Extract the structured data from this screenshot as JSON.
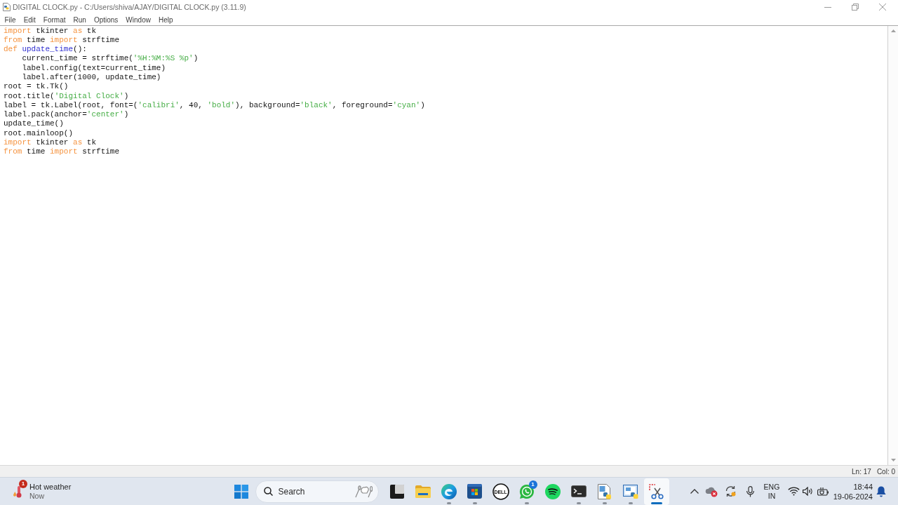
{
  "window": {
    "title": "DIGITAL CLOCK.py - C:/Users/shiva/AJAY/DIGITAL CLOCK.py (3.11.9)"
  },
  "menu": [
    "File",
    "Edit",
    "Format",
    "Run",
    "Options",
    "Window",
    "Help"
  ],
  "editor": {
    "lines": [
      {
        "tokens": [
          {
            "text": "import",
            "kind": "keyword"
          },
          {
            "text": " tkinter ",
            "kind": "plain"
          },
          {
            "text": "as",
            "kind": "keyword"
          },
          {
            "text": " tk",
            "kind": "plain"
          }
        ]
      },
      {
        "tokens": [
          {
            "text": "from",
            "kind": "keyword"
          },
          {
            "text": " time ",
            "kind": "plain"
          },
          {
            "text": "import",
            "kind": "keyword"
          },
          {
            "text": " strftime",
            "kind": "plain"
          }
        ]
      },
      {
        "tokens": [
          {
            "text": "def",
            "kind": "keyword"
          },
          {
            "text": " update_time",
            "kind": "definition"
          },
          {
            "text": "():",
            "kind": "plain"
          }
        ]
      },
      {
        "tokens": [
          {
            "text": "    current_time = strftime(",
            "kind": "plain"
          },
          {
            "text": "'%H:%M:%S %p'",
            "kind": "string"
          },
          {
            "text": ")",
            "kind": "plain"
          }
        ]
      },
      {
        "tokens": [
          {
            "text": "    label.config(text=current_time)",
            "kind": "plain"
          }
        ]
      },
      {
        "tokens": [
          {
            "text": "    label.after(1000, update_time)",
            "kind": "plain"
          }
        ]
      },
      {
        "tokens": [
          {
            "text": "root = tk.Tk()",
            "kind": "plain"
          }
        ]
      },
      {
        "tokens": [
          {
            "text": "root.title(",
            "kind": "plain"
          },
          {
            "text": "'Digital Clock'",
            "kind": "string"
          },
          {
            "text": ")",
            "kind": "plain"
          }
        ]
      },
      {
        "tokens": [
          {
            "text": "label = tk.Label(root, font=(",
            "kind": "plain"
          },
          {
            "text": "'calibri'",
            "kind": "string"
          },
          {
            "text": ", 40, ",
            "kind": "plain"
          },
          {
            "text": "'bold'",
            "kind": "string"
          },
          {
            "text": "), background=",
            "kind": "plain"
          },
          {
            "text": "'black'",
            "kind": "string"
          },
          {
            "text": ", foreground=",
            "kind": "plain"
          },
          {
            "text": "'cyan'",
            "kind": "string"
          },
          {
            "text": ")",
            "kind": "plain"
          }
        ]
      },
      {
        "tokens": [
          {
            "text": "label.pack(anchor=",
            "kind": "plain"
          },
          {
            "text": "'center'",
            "kind": "string"
          },
          {
            "text": ")",
            "kind": "plain"
          }
        ]
      },
      {
        "tokens": [
          {
            "text": "update_time()",
            "kind": "plain"
          }
        ]
      },
      {
        "tokens": [
          {
            "text": "root.mainloop()",
            "kind": "plain"
          }
        ]
      },
      {
        "tokens": [
          {
            "text": "import",
            "kind": "keyword"
          },
          {
            "text": " tkinter ",
            "kind": "plain"
          },
          {
            "text": "as",
            "kind": "keyword"
          },
          {
            "text": " tk",
            "kind": "plain"
          }
        ]
      },
      {
        "tokens": [
          {
            "text": "from",
            "kind": "keyword"
          },
          {
            "text": " time ",
            "kind": "plain"
          },
          {
            "text": "import",
            "kind": "keyword"
          },
          {
            "text": " strftime",
            "kind": "plain"
          }
        ]
      }
    ]
  },
  "status_bar": {
    "line": "Ln: 17",
    "column": "Col: 0"
  },
  "taskbar": {
    "weather": {
      "title": "Hot weather",
      "subtitle": "Now",
      "badge": "1"
    },
    "search": {
      "label": "Search"
    },
    "apps": [
      {
        "kind": "task-view",
        "running": false,
        "selected": false
      },
      {
        "kind": "folder",
        "running": false,
        "selected": false
      },
      {
        "kind": "browser",
        "running": true,
        "selected": false
      },
      {
        "kind": "store",
        "running": true,
        "selected": false
      },
      {
        "kind": "ring-logo",
        "logo_text": "DELL",
        "running": false,
        "selected": false
      },
      {
        "kind": "chat",
        "badge": "1",
        "running": true,
        "selected": false
      },
      {
        "kind": "music",
        "running": false,
        "selected": false
      },
      {
        "kind": "terminal",
        "running": true,
        "selected": false
      },
      {
        "kind": "script-file",
        "running": true,
        "selected": false
      },
      {
        "kind": "script-window",
        "running": true,
        "selected": false
      },
      {
        "kind": "snipping",
        "running": true,
        "selected": true
      }
    ],
    "tray": {
      "language": "ENG",
      "region": "IN",
      "time": "18:44",
      "date": "19-06-2024"
    }
  }
}
